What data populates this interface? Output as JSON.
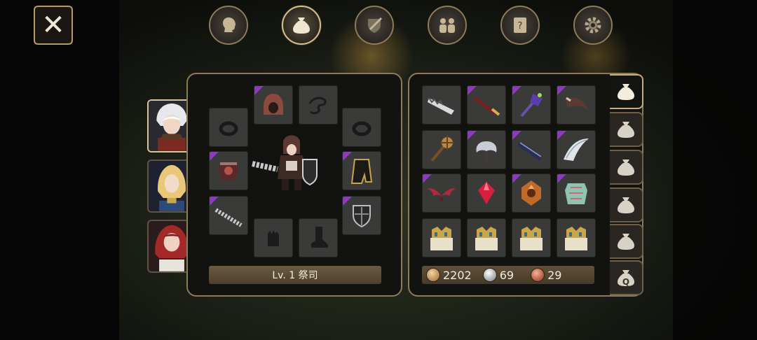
{
  "nav": {
    "close_icon": "close-icon",
    "tabs": [
      {
        "name": "character",
        "icon": "head-silhouette-icon",
        "active": false
      },
      {
        "name": "inventory",
        "icon": "bag-icon",
        "active": true
      },
      {
        "name": "skills",
        "icon": "sword-shield-icon",
        "active": false
      },
      {
        "name": "party",
        "icon": "people-icon",
        "active": false
      },
      {
        "name": "quest",
        "icon": "scroll-icon",
        "active": false
      },
      {
        "name": "settings",
        "icon": "gear-icon",
        "active": false
      }
    ]
  },
  "characters": [
    {
      "portrait": "white-haired-warrior",
      "active": true
    },
    {
      "portrait": "blonde-elf",
      "active": false
    },
    {
      "portrait": "red-haired-priestess",
      "active": false
    }
  ],
  "equipment": {
    "level_label": "Lv. 1 祭司",
    "slots": [
      {
        "slot": "ring-left",
        "item": "ring",
        "rare": false
      },
      {
        "slot": "helmet",
        "item": "hood",
        "rare": true
      },
      {
        "slot": "cape",
        "item": "cape",
        "rare": false
      },
      {
        "slot": "ring-right",
        "item": "ring",
        "rare": false
      },
      {
        "slot": "armor",
        "item": "chest-armor",
        "rare": true
      },
      {
        "slot": "cloak",
        "item": "cloak",
        "rare": true
      },
      {
        "slot": "weapon",
        "item": "flail",
        "rare": true
      },
      {
        "slot": "shield",
        "item": "shield",
        "rare": true
      },
      {
        "slot": "gloves",
        "item": "gloves",
        "rare": false
      },
      {
        "slot": "boots",
        "item": "boots",
        "rare": false
      }
    ]
  },
  "inventory": {
    "items": [
      {
        "item": "jagged-blade",
        "rare": false
      },
      {
        "item": "red-greatsword",
        "rare": true
      },
      {
        "item": "purple-hammer",
        "rare": true
      },
      {
        "item": "curved-blade",
        "rare": true
      },
      {
        "item": "mace",
        "rare": false
      },
      {
        "item": "battle-axe",
        "rare": true
      },
      {
        "item": "dark-sword",
        "rare": true
      },
      {
        "item": "crescent-blade",
        "rare": true
      },
      {
        "item": "red-wings",
        "rare": true
      },
      {
        "item": "ruby-gem",
        "rare": false
      },
      {
        "item": "ornate-medallion",
        "rare": true
      },
      {
        "item": "jade-armor",
        "rare": true
      },
      {
        "item": "treasure-chest",
        "rare": false
      },
      {
        "item": "treasure-chest",
        "rare": false
      },
      {
        "item": "treasure-chest",
        "rare": false
      },
      {
        "item": "treasure-chest",
        "rare": false
      }
    ],
    "currency": {
      "gold": "2202",
      "silver": "69",
      "copper": "29"
    }
  },
  "bag_tabs": [
    {
      "label": "",
      "icon": "bag-icon",
      "active": true
    },
    {
      "label": "",
      "icon": "bag-icon",
      "active": false
    },
    {
      "label": "",
      "icon": "bag-icon",
      "active": false
    },
    {
      "label": "",
      "icon": "bag-icon",
      "active": false
    },
    {
      "label": "",
      "icon": "bag-icon",
      "active": false
    },
    {
      "label": "Q",
      "icon": "quest-bag-icon",
      "active": false
    }
  ]
}
